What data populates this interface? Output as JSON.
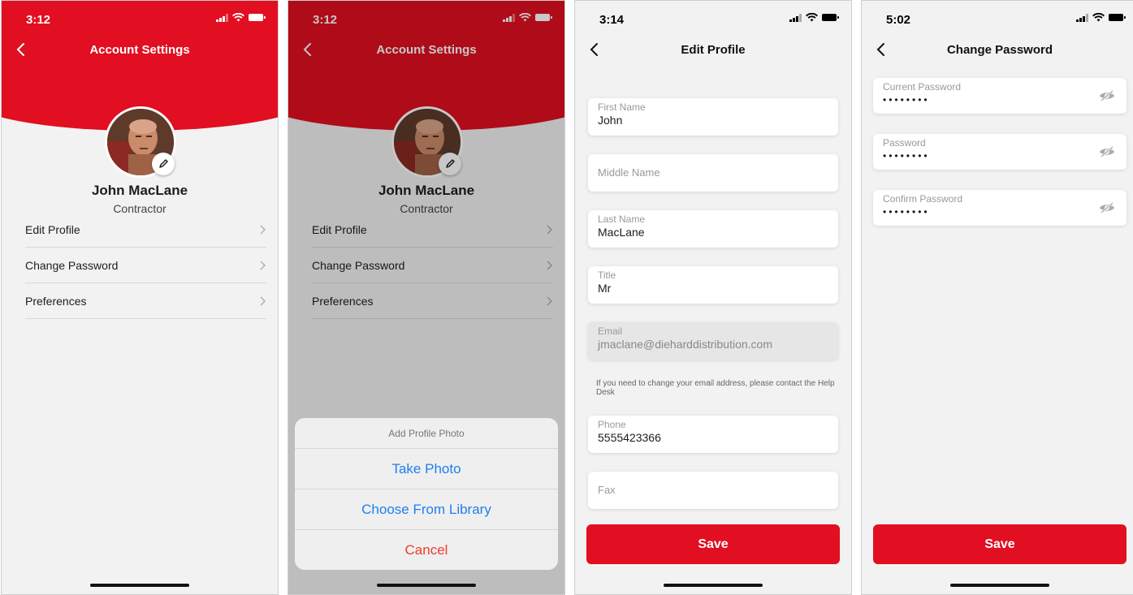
{
  "screens": [
    {
      "status": {
        "time": "3:12"
      },
      "nav": {
        "title": "Account Settings"
      },
      "profile": {
        "name": "John MacLane",
        "role": "Contractor"
      },
      "menu": [
        {
          "label": "Edit Profile"
        },
        {
          "label": "Change Password"
        },
        {
          "label": "Preferences"
        }
      ]
    },
    {
      "status": {
        "time": "3:12"
      },
      "nav": {
        "title": "Account Settings"
      },
      "profile": {
        "name": "John MacLane",
        "role": "Contractor"
      },
      "menu": [
        {
          "label": "Edit Profile"
        },
        {
          "label": "Change Password"
        },
        {
          "label": "Preferences"
        }
      ],
      "action_sheet": {
        "title": "Add Profile Photo",
        "take_photo": "Take Photo",
        "choose_library": "Choose From Library",
        "cancel": "Cancel"
      }
    },
    {
      "status": {
        "time": "3:14"
      },
      "nav": {
        "title": "Edit Profile"
      },
      "fields": {
        "first_name": {
          "label": "First Name",
          "value": "John"
        },
        "middle_name": {
          "placeholder": "Middle Name"
        },
        "last_name": {
          "label": "Last Name",
          "value": "MacLane"
        },
        "title": {
          "label": "Title",
          "value": "Mr"
        },
        "email": {
          "label": "Email",
          "value": "jmaclane@dieharddistribution.com"
        },
        "phone": {
          "label": "Phone",
          "value": "5555423366"
        },
        "fax": {
          "placeholder": "Fax"
        }
      },
      "email_note": "If you need to change your email address, please contact the Help Desk",
      "save": "Save"
    },
    {
      "status": {
        "time": "5:02"
      },
      "nav": {
        "title": "Change Password"
      },
      "fields": {
        "current": {
          "label": "Current Password",
          "value": "••••••••"
        },
        "password": {
          "label": "Password",
          "value": "••••••••"
        },
        "confirm": {
          "label": "Confirm Password",
          "value": "••••••••"
        }
      },
      "save": "Save"
    }
  ],
  "colors": {
    "brand_red": "#e10f21",
    "action_blue": "#1f7ef2",
    "cancel_red": "#ee3b2d"
  },
  "icons": [
    "back-chevron-icon",
    "signal-icon",
    "wifi-icon",
    "battery-icon",
    "pencil-icon",
    "chevron-right-icon",
    "eye-hidden-icon"
  ]
}
